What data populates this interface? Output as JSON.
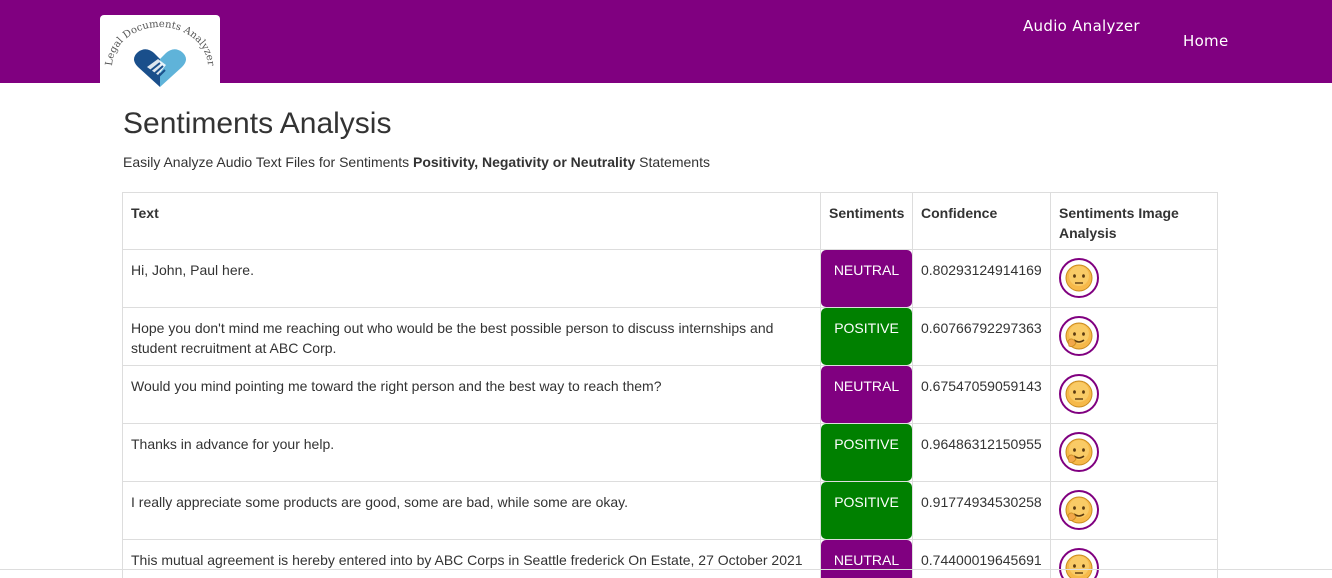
{
  "navbar": {
    "brand_logo_text": "Legal Documents Analyzer",
    "links": [
      {
        "label": "Audio Analyzer"
      },
      {
        "label": "Home"
      }
    ],
    "background_color": "#800080"
  },
  "main": {
    "title": "Sentiments Analysis",
    "subtitle_pre": "Easily Analyze Audio Text Files for Sentiments ",
    "subtitle_bold": "Positivity, Negativity or Neutrality",
    "subtitle_post": " Statements"
  },
  "table": {
    "headers": [
      "Text",
      "Sentiments",
      "Confidence",
      "Sentiments Image Analysis"
    ],
    "rows": [
      {
        "text": "Hi, John, Paul here.",
        "sentiment": "NEUTRAL",
        "confidence": "0.80293124914169",
        "face": "neutral-face-icon"
      },
      {
        "text": "Hope you don't mind me reaching out who would be the best possible person to discuss internships and student recruitment at ABC Corp.",
        "sentiment": "POSITIVE",
        "confidence": "0.60766792297363",
        "face": "positive-face-icon"
      },
      {
        "text": "Would you mind pointing me toward the right person and the best way to reach them?",
        "sentiment": "NEUTRAL",
        "confidence": "0.67547059059143",
        "face": "neutral-face-icon"
      },
      {
        "text": "Thanks in advance for your help.",
        "sentiment": "POSITIVE",
        "confidence": "0.96486312150955",
        "face": "positive-face-icon"
      },
      {
        "text": "I really appreciate some products are good, some are bad, while some are okay.",
        "sentiment": "POSITIVE",
        "confidence": "0.91774934530258",
        "face": "positive-face-icon"
      },
      {
        "text": "This mutual agreement is hereby entered into by ABC Corps in Seattle frederick On Estate, 27 October 2021",
        "sentiment": "NEUTRAL",
        "confidence": "0.74400019645691",
        "face": "neutral-face-icon"
      }
    ]
  },
  "colors": {
    "neutral": "#800080",
    "positive": "#008000"
  }
}
